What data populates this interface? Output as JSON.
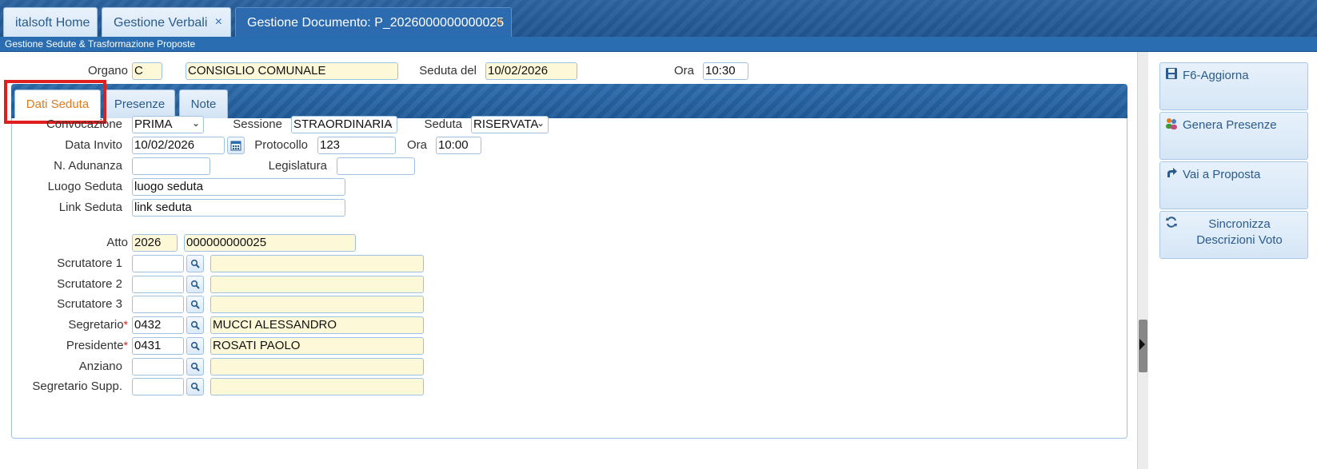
{
  "tabs": [
    {
      "label": "italsoft Home"
    },
    {
      "label": "Gestione Verbali",
      "close": "×"
    },
    {
      "label": "Gestione Documento: P_2026000000000025",
      "close": "×"
    }
  ],
  "subheader": {
    "title": "Gestione Sedute & Trasformazione Proposte"
  },
  "header": {
    "organo_label": "Organo",
    "organo_code": "C",
    "organo_desc": "CONSIGLIO COMUNALE",
    "seduta_del_label": "Seduta del",
    "seduta_del_value": "10/02/2026",
    "ora_label": "Ora",
    "ora_value": "10:30"
  },
  "panel_tabs": [
    {
      "label": "Dati Seduta",
      "active": true
    },
    {
      "label": "Presenze"
    },
    {
      "label": "Note"
    }
  ],
  "form": {
    "convocazione": {
      "label": "Convocazione",
      "value": "PRIMA"
    },
    "sessione": {
      "label": "Sessione",
      "value": "STRAORDINARIA"
    },
    "seduta": {
      "label": "Seduta",
      "value": "RISERVATA"
    },
    "data_invito": {
      "label": "Data Invito",
      "value": "10/02/2026"
    },
    "protocollo": {
      "label": "Protocollo",
      "value": "123"
    },
    "ora": {
      "label": "Ora",
      "value": "10:00"
    },
    "n_adunanza": {
      "label": "N. Adunanza",
      "value": ""
    },
    "legislatura": {
      "label": "Legislatura",
      "value": ""
    },
    "luogo_seduta": {
      "label": "Luogo Seduta",
      "value": "luogo seduta"
    },
    "link_seduta": {
      "label": "Link Seduta",
      "value": "link seduta"
    },
    "atto": {
      "label": "Atto",
      "anno": "2026",
      "numero": "000000000025"
    },
    "people": [
      {
        "label": "Scrutatore 1",
        "code": "",
        "name": "",
        "required": false
      },
      {
        "label": "Scrutatore 2",
        "code": "",
        "name": "",
        "required": false
      },
      {
        "label": "Scrutatore 3",
        "code": "",
        "name": "",
        "required": false
      },
      {
        "label": "Segretario",
        "code": "0432",
        "name": "MUCCI ALESSANDRO",
        "required": true
      },
      {
        "label": "Presidente",
        "code": "0431",
        "name": "ROSATI PAOLO",
        "required": true
      },
      {
        "label": "Anziano",
        "code": "",
        "name": "",
        "required": false
      },
      {
        "label": "Segretario Supp.",
        "code": "",
        "name": "",
        "required": false
      }
    ],
    "required_mark": "*"
  },
  "actions": [
    {
      "label": "F6-Aggiorna",
      "icon": "save-icon"
    },
    {
      "label": "Genera Presenze",
      "icon": "users-icon"
    },
    {
      "label": "Vai a Proposta",
      "icon": "redirect-arrow-icon"
    },
    {
      "label": "Sincronizza Descrizioni Voto",
      "icon": "sync-icon"
    }
  ],
  "colors": {
    "accent": "#2a6db0",
    "active_tab_text": "#e07a1c",
    "readonly_bg": "#fdf8d8",
    "highlight": "#e01e1e"
  }
}
